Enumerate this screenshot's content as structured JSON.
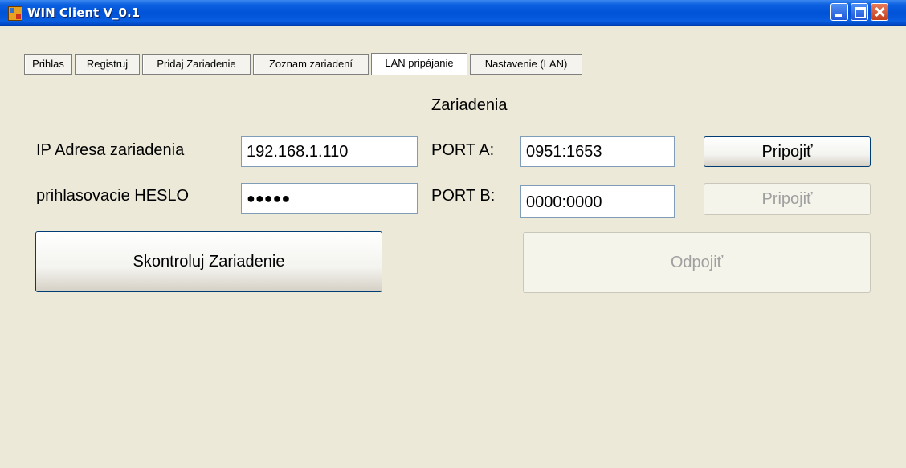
{
  "window": {
    "title": "WIN Client V_0.1"
  },
  "tabs": [
    {
      "label": "Prihlas"
    },
    {
      "label": "Registruj"
    },
    {
      "label": "Pridaj Zariadenie"
    },
    {
      "label": "Zoznam zariadení"
    },
    {
      "label": "LAN pripájanie",
      "active": true
    },
    {
      "label": "Nastavenie (LAN)"
    }
  ],
  "main": {
    "section_title": "Zariadenia",
    "ip_label": "IP Adresa zariadenia",
    "ip_value": "192.168.1.110",
    "password_label": "prihlasovacie HESLO",
    "password_masked": "●●●●●",
    "port_a_label": "PORT A:",
    "port_a_value": "0951:1653",
    "port_a_button": "Pripojiť",
    "port_b_label": "PORT B:",
    "port_b_value": "0000:0000",
    "port_b_button": "Pripojiť",
    "check_button": "Skontroluj Zariadenie",
    "disconnect_button": "Odpojiť"
  }
}
